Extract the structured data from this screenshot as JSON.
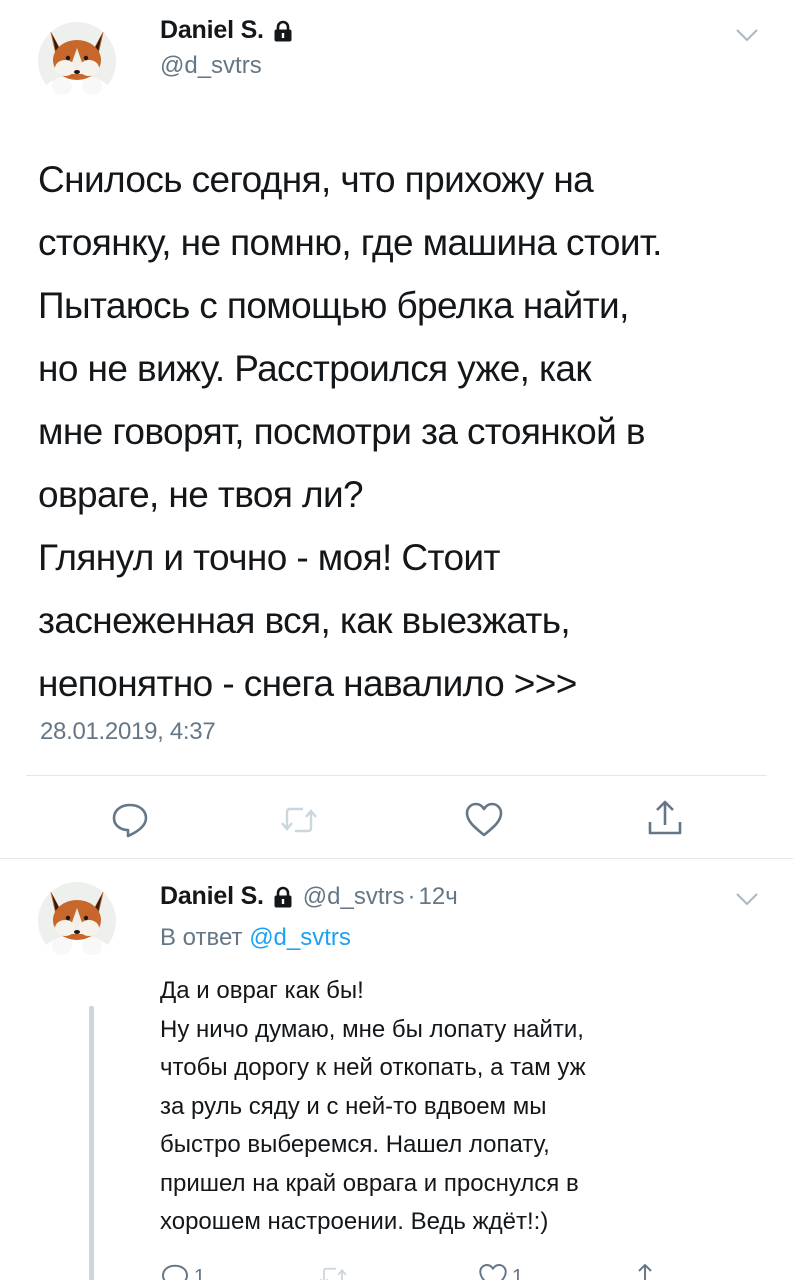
{
  "tweet": {
    "author_name": "Daniel S.",
    "author_handle": "@d_svtrs",
    "text_lines": [
      "Снилось сегодня, что прихожу на",
      "стоянку, не помню, где машина стоит.",
      "Пытаюсь с помощью брелка найти,",
      "но не вижу. Расстроился уже, как",
      "мне говорят, посмотри за стоянкой в",
      "овраге, не твоя ли?",
      "Глянул и точно - моя! Стоит",
      "заснеженная вся, как выезжать,",
      "непонятно - снега навалило >>>"
    ],
    "timestamp": "28.01.2019, 4:37",
    "actions": [
      "reply-icon",
      "retweet-icon",
      "like-icon",
      "share-icon"
    ],
    "colors": {
      "action_gray": "#657786",
      "retweet_disabled": "#ccd6dd"
    }
  },
  "reply": {
    "author_name": "Daniel S.",
    "author_handle": "@d_svtrs",
    "separator": "·",
    "time_ago": "12ч",
    "in_reply_prefix": "В ответ",
    "in_reply_handle": "@d_svtrs",
    "text_lines": [
      "Да и овраг как бы!",
      "Ну ничо думаю, мне бы лопату найти,",
      "чтобы дорогу к ней откопать, а там уж",
      "за руль сяду и с ней-то вдвоем мы",
      "быстро выберемся. Нашел лопату,",
      "пришел на край оврага и проснулся в",
      "хорошем настроении. Ведь ждёт!:)"
    ],
    "reply_count": "1",
    "like_count": "1",
    "colors": {
      "link": "#1da1f2",
      "thread_line": "#ccd6dd"
    }
  }
}
